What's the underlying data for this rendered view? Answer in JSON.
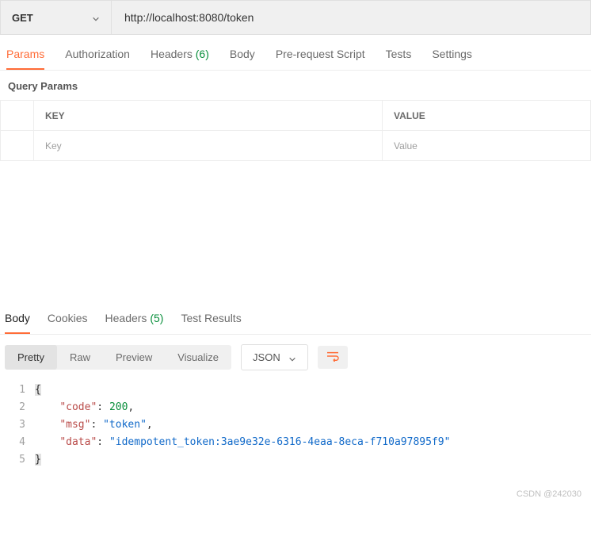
{
  "request": {
    "method": "GET",
    "url": "http://localhost:8080/token"
  },
  "tabs": {
    "params": "Params",
    "authorization": "Authorization",
    "headers_label": "Headers",
    "headers_count": "(6)",
    "body": "Body",
    "prerequest": "Pre-request Script",
    "tests": "Tests",
    "settings": "Settings"
  },
  "params_section": {
    "title": "Query Params",
    "col_key": "KEY",
    "col_value": "VALUE",
    "placeholder_key": "Key",
    "placeholder_value": "Value"
  },
  "resp_tabs": {
    "body": "Body",
    "cookies": "Cookies",
    "headers_label": "Headers",
    "headers_count": "(5)",
    "test_results": "Test Results"
  },
  "view": {
    "pretty": "Pretty",
    "raw": "Raw",
    "preview": "Preview",
    "visualize": "Visualize",
    "type": "JSON"
  },
  "response_body": {
    "ln1": "1",
    "ln2": "2",
    "ln3": "3",
    "ln4": "4",
    "ln5": "5",
    "brace_open": "{",
    "brace_close": "}",
    "indent": "    ",
    "k_code": "\"code\"",
    "v_code": "200",
    "k_msg": "\"msg\"",
    "v_msg": "\"token\"",
    "k_data": "\"data\"",
    "v_data": "\"idempotent_token:3ae9e32e-6316-4eaa-8eca-f710a97895f9\"",
    "colon": ": ",
    "comma": ","
  },
  "watermark": "CSDN @242030"
}
